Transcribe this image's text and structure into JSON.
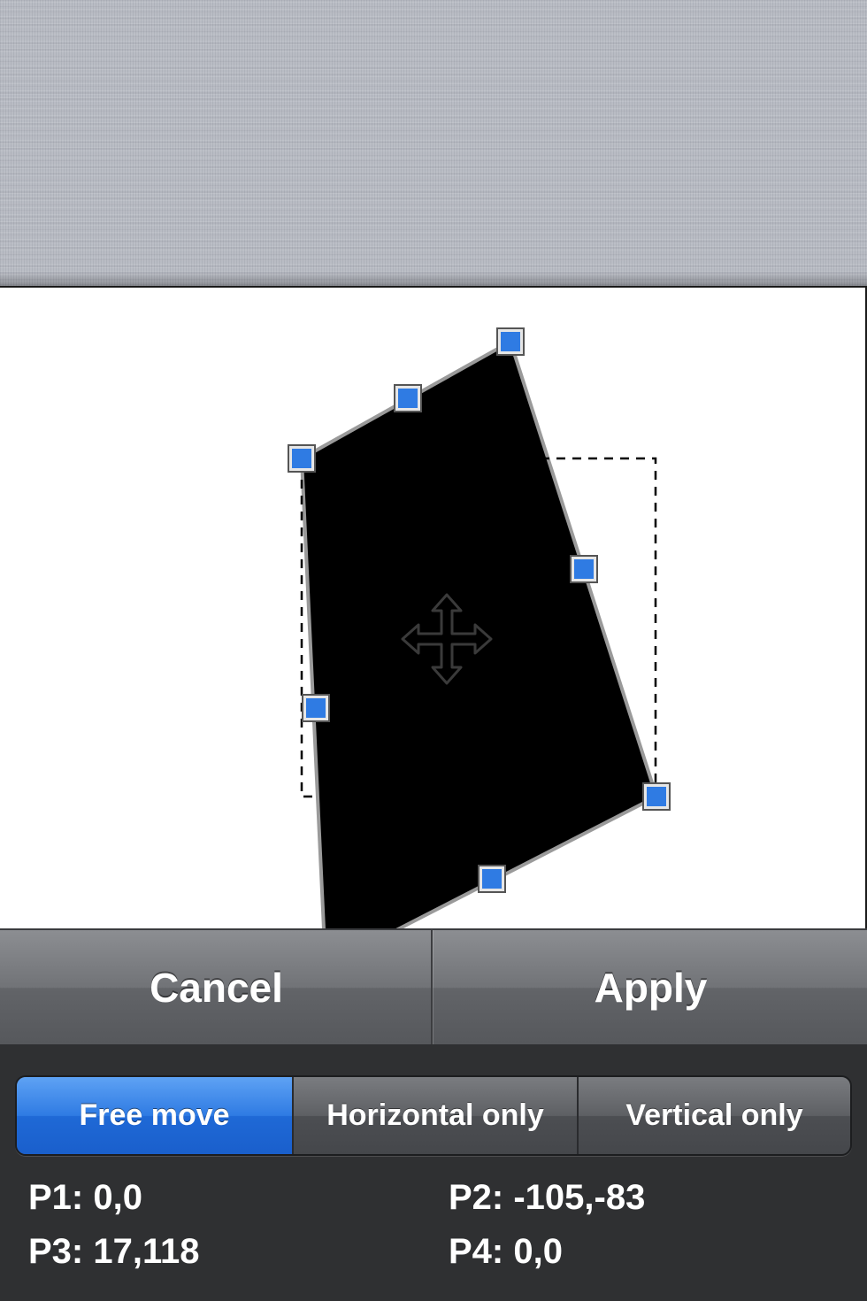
{
  "actions": {
    "cancel_label": "Cancel",
    "apply_label": "Apply"
  },
  "mode_control": {
    "options": [
      "Free move",
      "Horizontal only",
      "Vertical only"
    ],
    "selected": "Free move"
  },
  "points": {
    "p1": "P1: 0,0",
    "p2": "P2: -105,-83",
    "p3": "P3: 17,118",
    "p4": "P4: 0,0"
  },
  "icons": {
    "center": "move-arrows-icon",
    "handle": "corner-handle"
  },
  "colors": {
    "shape_fill": "#000000",
    "handle": "#2f7be3",
    "selected_segment": "#2f7be3",
    "background_linen": "#b9bcc4"
  }
}
